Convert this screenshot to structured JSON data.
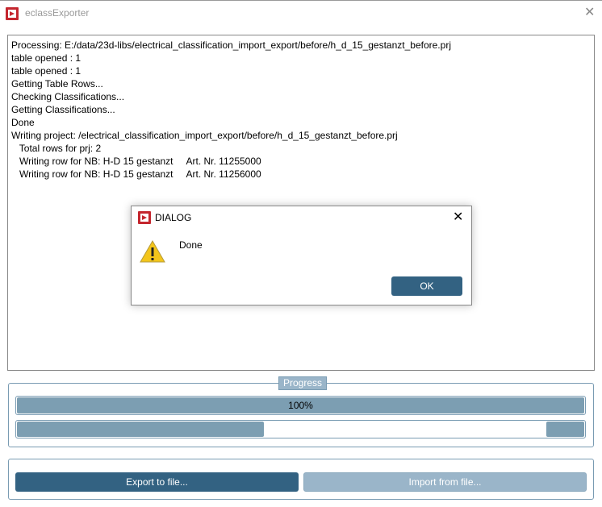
{
  "window": {
    "title": "eclassExporter",
    "close_icon": "close-icon"
  },
  "log": [
    "Processing: E:/data/23d-libs/electrical_classification_import_export/before/h_d_15_gestanzt_before.prj",
    "table opened : 1",
    "table opened : 1",
    "Getting Table Rows...",
    "Checking Classifications...",
    "Getting Classifications...",
    "Done",
    "Writing project: /electrical_classification_import_export/before/h_d_15_gestanzt_before.prj",
    "   Total rows for prj: 2",
    "   Writing row for NB: H-D 15 gestanzt     Art. Nr. 11255000",
    "   Writing row for NB: H-D 15 gestanzt     Art. Nr. 11256000"
  ],
  "progress": {
    "legend": "Progress",
    "main_label": "100%",
    "main_value": 100
  },
  "buttons": {
    "export": "Export to file...",
    "import": "Import from file..."
  },
  "dialog": {
    "title": "DIALOG",
    "message": "Done",
    "ok": "OK"
  },
  "colors": {
    "accent": "#336282",
    "disabled": "#9ab5c9",
    "bar": "#7c9eb2",
    "brand": "#c4262e"
  }
}
